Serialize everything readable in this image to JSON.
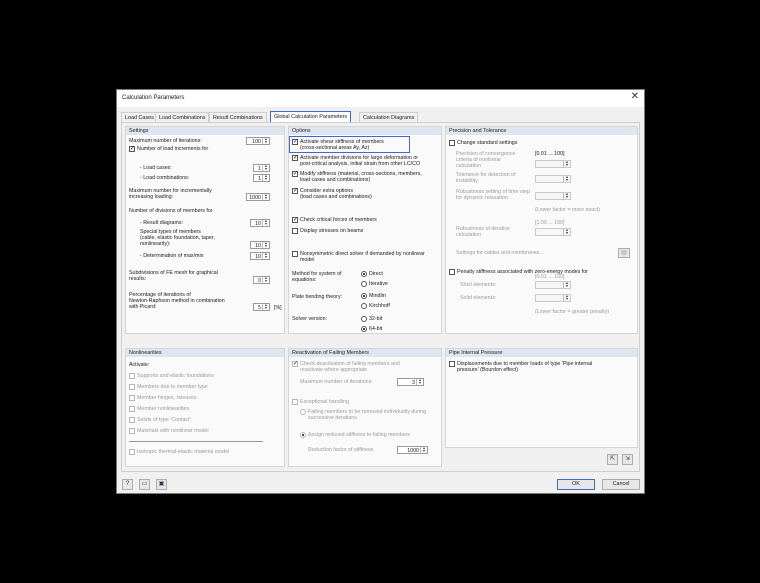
{
  "dialog": {
    "title": "Calculation Parameters",
    "close_glyph": "✕",
    "tabs": [
      "Load Cases",
      "Load Combinations",
      "Result Combinations",
      "Global Calculation Parameters",
      "Calculation Diagrams"
    ],
    "active_tab": 3
  },
  "settings": {
    "header": "Settings",
    "max_iter_label": "Maximum number of iterations:",
    "max_iter": "100",
    "num_load_incr_label": "Number of load increments for",
    "load_cases_label": "- Load cases:",
    "load_cases": "1",
    "load_comb_label": "- Load combinations:",
    "load_comb": "1",
    "max_iter_incr_label_1": "Maximum number for incrementally",
    "max_iter_incr_label_2": "increasing loading:",
    "max_iter_incr": "1000",
    "num_div_label": "Number of divisions of members for",
    "result_diag_label": "- Result diagrams:",
    "result_diag": "10",
    "special_types_1": "Special types of members",
    "special_types_2": "(cable, elastic foundation, taper,",
    "special_types_3": "nonlinearity):",
    "special_types": "10",
    "det_maxmin_label": "- Determination of max/min",
    "det_maxmin": "10",
    "subdiv_fe_1": "Subdivisions of FE mesh for graphical",
    "subdiv_fe_2": "results:",
    "subdiv_fe": "0",
    "pct_iter_1": "Percentage of iterations of",
    "pct_iter_2": "Newton-Raphson method in combination",
    "pct_iter_3": "with Picard:",
    "pct_iter": "5",
    "pct_unit": "[%]"
  },
  "options": {
    "header": "Options",
    "shear_1": "Activate shear stiffness of members",
    "shear_2": "(cross-sectional areas Ay, Az)",
    "member_div_1": "Activate member divisions for large deformation or",
    "member_div_2": "post-critical analysis, initial strain from other LC/CO",
    "modify_1": "Modify stiffness (material, cross-sections, members,",
    "modify_2": "load cases and combinations)",
    "extra_1": "Consider extra options",
    "extra_2": "(load cases and combinations)",
    "crit_forces": "Check critical forces of members",
    "disp_beams": "Display stresses on beams",
    "nonsym_1": "Nonsymmetric direct solver if demanded by nonlinear",
    "nonsym_2": "model",
    "method_1": "Method for system of",
    "method_2": "equations:",
    "direct": "Direct",
    "iterative": "Iterative",
    "plate_label": "Plate bending theory:",
    "mindlin": "Mindlin",
    "kirchhoff": "Kirchhoff",
    "solver_label": "Solver version:",
    "bit32": "32-bit",
    "bit64": "64-bit"
  },
  "precision": {
    "header": "Precision and Tolerance",
    "change_std": "Change standard settings",
    "conv_1": "Precision of convergence",
    "conv_2": "criteria of nonlinear",
    "conv_3": "calculation",
    "conv_range": "[0.01 ... 100]",
    "tol_1": "Tolerance for detection of",
    "tol_2": "instability",
    "rel_1": "Robustness setting of time step",
    "rel_2": "for dynamic relaxation",
    "lower_factor": "(Lower factor = more exact)",
    "rob_range": "[1.00 ... 100]",
    "rob_1": "Robustness of iterative",
    "rob_2": "calculation",
    "cable_settings": "Settings for cables and membranes...",
    "penalty": "Penalty stiffness associated with zero-energy modes for",
    "shell_el": "Shell elements:",
    "solid_el": "Solid elements:",
    "pen_range": "[0.01 ... 100]",
    "lower_stiff": "(Lower factor = greater penalty)"
  },
  "nonlinear": {
    "header": "Nonlinearities",
    "activate": "Activate:",
    "items": [
      "Supports and elastic foundations",
      "Members due to member type",
      "Member hinges, releases",
      "Member nonlinearities",
      "Solids of type 'Contact'",
      "Materials with nonlinear model"
    ],
    "isotropic": "Isotropic thermal-elastic material model"
  },
  "deact": {
    "header": "Reactivation of Failing Members",
    "check_1": "Check deactivation of failing members and",
    "check_2": "reactivate where appropriate",
    "max_iter_label": "Maximum number of iterations:",
    "max_iter": "3",
    "exceptional": "Exceptional handling",
    "fail_1": "Failing members to be removed individually during",
    "fail_2": "successive iterations",
    "assign": "Assign reduced stiffness to failing members",
    "reduction_label": "Reduction factor of stiffness",
    "reduction": "1000"
  },
  "pipe": {
    "header": "Pipe Internal Pressure",
    "disp_1": "Displacements due to member loads of type 'Pipe internal",
    "disp_2": "pressure' (Bourdon effect)"
  },
  "footer": {
    "ok": "OK",
    "cancel": "Cancel"
  }
}
